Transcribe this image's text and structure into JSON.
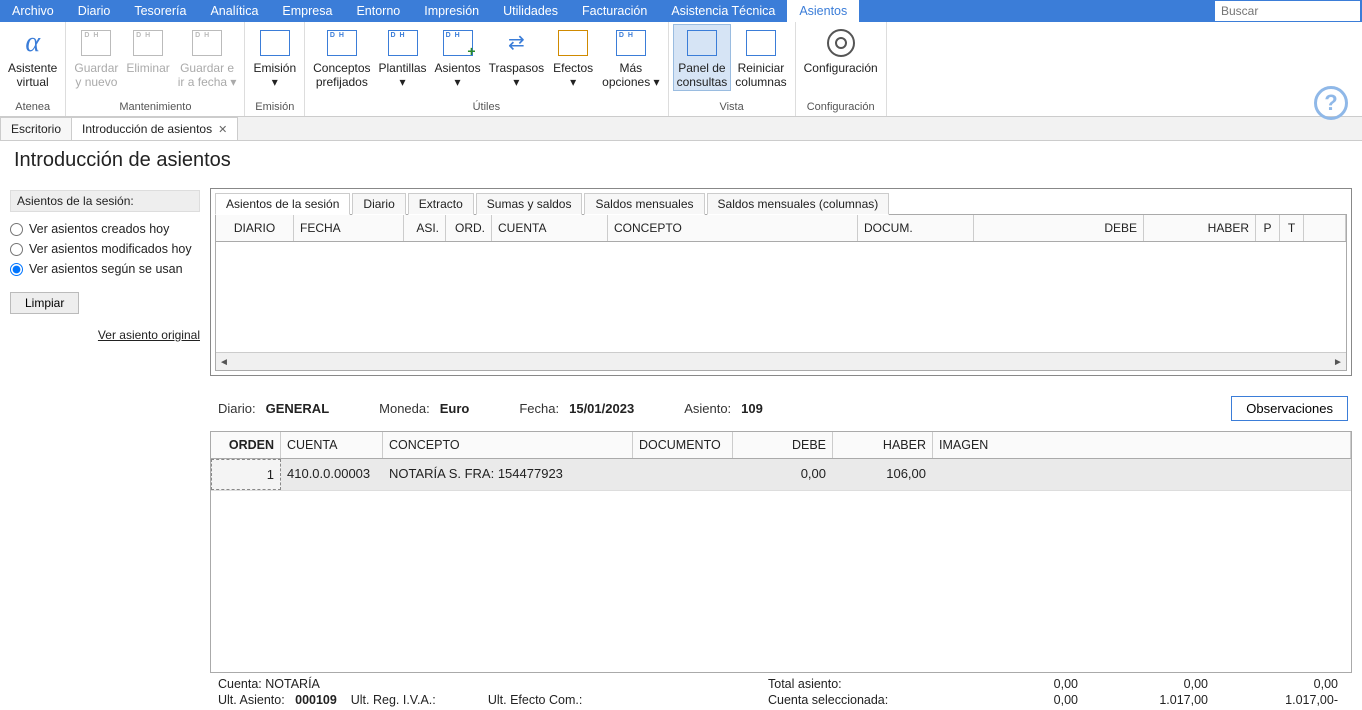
{
  "menubar": {
    "items": [
      "Archivo",
      "Diario",
      "Tesorería",
      "Analítica",
      "Empresa",
      "Entorno",
      "Impresión",
      "Utilidades",
      "Facturación",
      "Asistencia Técnica",
      "Asientos"
    ],
    "active_index": 10,
    "search_placeholder": "Buscar"
  },
  "ribbon": {
    "groups": [
      {
        "label": "Atenea",
        "buttons": [
          {
            "line1": "Asistente",
            "line2": "virtual",
            "icon": "alpha-icon",
            "disabled": false
          }
        ]
      },
      {
        "label": "Mantenimiento",
        "buttons": [
          {
            "line1": "Guardar",
            "line2": "y nuevo",
            "icon": "doc-icon",
            "disabled": true
          },
          {
            "line1": "Eliminar",
            "line2": "",
            "icon": "doc-icon",
            "disabled": true
          },
          {
            "line1": "Guardar e",
            "line2": "ir a fecha ▾",
            "icon": "doc-icon",
            "disabled": true
          }
        ]
      },
      {
        "label": "Emisión",
        "buttons": [
          {
            "line1": "Emisión",
            "line2": "▾",
            "icon": "doc-check-icon",
            "disabled": false
          }
        ]
      },
      {
        "label": "Útiles",
        "buttons": [
          {
            "line1": "Conceptos",
            "line2": "prefijados",
            "icon": "dh-icon",
            "disabled": false
          },
          {
            "line1": "Plantillas",
            "line2": "▾",
            "icon": "dh-icon",
            "disabled": false
          },
          {
            "line1": "Asientos",
            "line2": "▾",
            "icon": "dh-plus-icon",
            "disabled": false
          },
          {
            "line1": "Traspasos",
            "line2": "▾",
            "icon": "arrows-icon",
            "disabled": false
          },
          {
            "line1": "Efectos",
            "line2": "▾",
            "icon": "effects-icon",
            "disabled": false
          },
          {
            "line1": "Más",
            "line2": "opciones ▾",
            "icon": "dh-icon",
            "disabled": false
          }
        ]
      },
      {
        "label": "Vista",
        "buttons": [
          {
            "line1": "Panel de",
            "line2": "consultas",
            "icon": "panel-icon",
            "disabled": false,
            "active": true
          },
          {
            "line1": "Reiniciar",
            "line2": "columnas",
            "icon": "columns-icon",
            "disabled": false
          }
        ]
      },
      {
        "label": "Configuración",
        "buttons": [
          {
            "line1": "Configuración",
            "line2": "",
            "icon": "gear-icon",
            "disabled": false
          }
        ]
      }
    ]
  },
  "doc_tabs": {
    "items": [
      {
        "label": "Escritorio",
        "closable": false
      },
      {
        "label": "Introducción de asientos",
        "closable": true
      }
    ],
    "active_index": 1
  },
  "page_title": "Introducción de asientos",
  "sidebar": {
    "header": "Asientos de la sesión:",
    "options": [
      "Ver asientos creados hoy",
      "Ver asientos modificados hoy",
      "Ver asientos según se usan"
    ],
    "selected_index": 2,
    "clear_button": "Limpiar",
    "link": "Ver asiento original"
  },
  "inner_tabs": {
    "items": [
      "Asientos de la sesión",
      "Diario",
      "Extracto",
      "Sumas y saldos",
      "Saldos mensuales",
      "Saldos mensuales (columnas)"
    ],
    "active_index": 0
  },
  "session_grid": {
    "columns": [
      "DIARIO",
      "FECHA",
      "ASI.",
      "ORD.",
      "CUENTA",
      "CONCEPTO",
      "DOCUM.",
      "DEBE",
      "HABER",
      "P",
      "T",
      ""
    ]
  },
  "info": {
    "diario_label": "Diario:",
    "diario_value": "GENERAL",
    "moneda_label": "Moneda:",
    "moneda_value": "Euro",
    "fecha_label": "Fecha:",
    "fecha_value": "15/01/2023",
    "asiento_label": "Asiento:",
    "asiento_value": "109",
    "obs_button": "Observaciones"
  },
  "entry_grid": {
    "columns": [
      "ORDEN",
      "CUENTA",
      "CONCEPTO",
      "DOCUMENTO",
      "DEBE",
      "HABER",
      "IMAGEN"
    ],
    "rows": [
      {
        "orden": "1",
        "cuenta": "410.0.0.00003",
        "concepto": "NOTARÍA S. FRA:   154477923",
        "documento": "",
        "debe": "0,00",
        "haber": "106,00",
        "imagen": ""
      }
    ]
  },
  "footer": {
    "cuenta_label": "Cuenta:",
    "cuenta_value": "NOTARÍA",
    "ult_asiento_label": "Ult. Asiento:",
    "ult_asiento_value": "000109",
    "ult_reg_iva_label": "Ult. Reg. I.V.A.:",
    "ult_efecto_label": "Ult. Efecto Com.:",
    "total_asiento_label": "Total asiento:",
    "cuenta_sel_label": "Cuenta seleccionada:",
    "vals_row1": [
      "0,00",
      "0,00",
      "0,00"
    ],
    "vals_row2": [
      "0,00",
      "1.017,00",
      "1.017,00-"
    ]
  }
}
